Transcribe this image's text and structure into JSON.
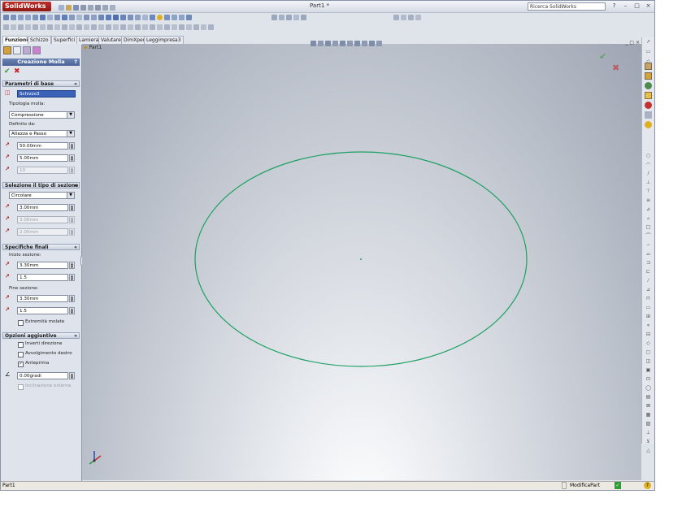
{
  "app": {
    "logo": "SolidWorks",
    "document_title": "Part1 *",
    "search_placeholder": "Ricerca SolidWorks",
    "help": "?",
    "min": "–",
    "max": "□",
    "close": "×"
  },
  "tabs": [
    {
      "label": "Funzioni",
      "active": true
    },
    {
      "label": "Schizzo"
    },
    {
      "label": "Superfici"
    },
    {
      "label": "Lamiera"
    },
    {
      "label": "Valutare"
    },
    {
      "label": "DimXpert"
    },
    {
      "label": "Leggimpresa3"
    }
  ],
  "tree": {
    "part_label": "Part1"
  },
  "property_manager": {
    "title": "Creazione Molla",
    "help": "?",
    "ok_icon": "✔",
    "cancel_icon": "✖",
    "sections": {
      "basic": {
        "title": "Parametri di base",
        "sketch_value": "Schizzo3",
        "spring_type_label": "Tipologia molla:",
        "spring_type_value": "Compressione",
        "defined_by_label": "Definito da:",
        "defined_by_value": "Altezza e Passo",
        "height_value": "50.00mm",
        "pitch_value": "5.00mm",
        "revolutions_value": "10"
      },
      "section_type": {
        "title": "Selezione il tipo di sezione",
        "type_value": "Circolare",
        "d1_value": "3.00mm",
        "d2_value": "3.00mm",
        "d3_value": "2.00mm"
      },
      "end_specs": {
        "title": "Specifiche finali",
        "start_label": "Inizio sezione:",
        "start_val1": "3.30mm",
        "start_val2": "1.5",
        "end_label": "Fine sezione:",
        "end_val1": "3.30mm",
        "end_val2": "1.5",
        "ground_ends_label": "Estremità molate",
        "ground_ends_checked": false
      },
      "options": {
        "title": "Opzioni aggiuntive",
        "invert_label": "Inverti direzione",
        "invert_checked": false,
        "right_hand_label": "Avvolgimento destro",
        "right_hand_checked": false,
        "preview_label": "Anteprima",
        "preview_checked": true,
        "angle_value": "0.00gradi",
        "external_label": "Inclinazione esterna",
        "external_checked": false
      }
    }
  },
  "status_bar": {
    "left_text": "Part1",
    "mode_text": "ModificaPart",
    "help": "?"
  },
  "colors": {
    "sketch_curve": "#1fa063",
    "accept": "#2f9a36",
    "reject": "#c8282c"
  }
}
